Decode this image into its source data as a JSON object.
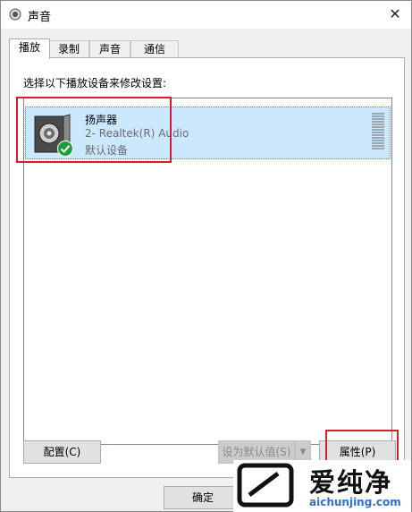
{
  "window": {
    "title": "声音",
    "close_glyph": "✕"
  },
  "tabs": [
    {
      "label": "播放",
      "active": true
    },
    {
      "label": "录制",
      "active": false
    },
    {
      "label": "声音",
      "active": false
    },
    {
      "label": "通信",
      "active": false
    }
  ],
  "panel": {
    "instruction": "选择以下播放设备来修改设置:"
  },
  "device": {
    "name": "扬声器",
    "subtitle": "2- Realtek(R) Audio",
    "status": "默认设备",
    "icon": "speaker-icon",
    "badge_icon": "check-badge-icon",
    "selected": true
  },
  "buttons": {
    "configure": "配置(C)",
    "set_default": "设为默认值(S)",
    "set_default_dropdown": "▼",
    "properties": "属性(P)",
    "ok": "确定"
  },
  "watermark": {
    "text": "爱纯净",
    "url": "aichunjing.com"
  },
  "colors": {
    "selection": "#cce8ff",
    "highlight": "#d0202e",
    "check_green": "#1e9e3c",
    "watermark_url": "#2f6fd0"
  }
}
